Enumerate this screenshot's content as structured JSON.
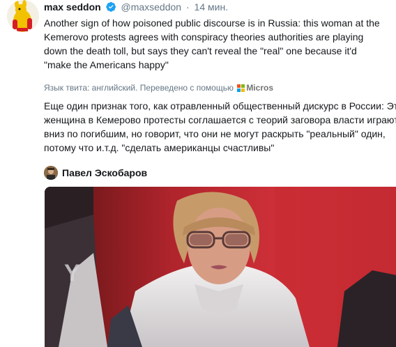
{
  "tweet": {
    "name": "max seddon",
    "handle": "@maxseddon",
    "separator": "·",
    "time": "14 мин.",
    "text": "Another sign of how poisoned public discourse is in Russia: this woman at the Kemerovo protests agrees with conspiracy theories authorities are playing down the death toll, but says they can't reveal the \"real\" one because it'd \"make the Americans happy\"",
    "translated_by": "Язык твита: английский. Переведено с помощью",
    "translator_brand": "Micros",
    "translation_lines": [
      "Еще один признак того, как отравленный общественный дискурс в России: Эта",
      "женщина в Кемерово протесты соглашается с теорий заговора власти играют",
      "вниз по погибшим, но говорит, что они не могут раскрыть \"реальный\" один,",
      "потому что и.т.д. \"сделать американцы счастливы\""
    ],
    "quoted_author": "Павел Эскобаров"
  },
  "colors": {
    "verified": "#1da1f2",
    "ms_red": "#f25022",
    "ms_green": "#7fba00",
    "ms_blue": "#00a4ef",
    "ms_yellow": "#ffb900"
  },
  "icons": {
    "verified": "verified-badge-icon",
    "translator": "microsoft-logo-icon"
  }
}
